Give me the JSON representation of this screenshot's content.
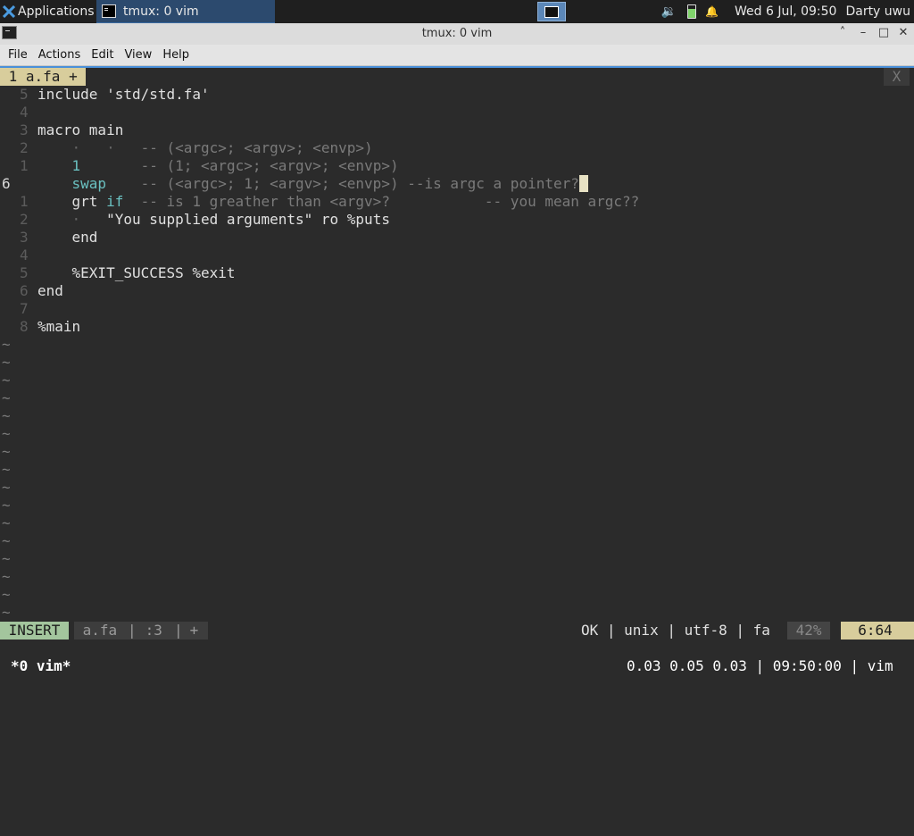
{
  "panel": {
    "apps_label": "Applications",
    "task_label": "tmux: 0 vim",
    "volume_icon": "🔉",
    "battery_icon": "▮",
    "bell_icon": "🔔",
    "clock": "Wed  6 Jul, 09:50",
    "user": "Darty uwu"
  },
  "window": {
    "title": "tmux: 0 vim",
    "minimize": "˄",
    "iconify": "–",
    "maximize": "□",
    "close": "✕"
  },
  "menu": [
    "File",
    "Actions",
    "Edit",
    "View",
    "Help"
  ],
  "vim": {
    "tab_label": " 1 a.fa + ",
    "tab_close": " X ",
    "lines": [
      {
        "nr": "5",
        "cur": false,
        "parts": [
          {
            "t": "include 'std/std.fa'",
            "c": ""
          }
        ]
      },
      {
        "nr": "4",
        "cur": false,
        "parts": []
      },
      {
        "nr": "3",
        "cur": false,
        "parts": [
          {
            "t": "macro main",
            "c": ""
          }
        ]
      },
      {
        "nr": "2",
        "cur": false,
        "parts": [
          {
            "t": "    ",
            "c": ""
          },
          {
            "t": "·   ·   ",
            "c": "dot"
          },
          {
            "t": "-- (<argc>; <argv>; <envp>)",
            "c": "cmt"
          }
        ]
      },
      {
        "nr": "1",
        "cur": false,
        "parts": [
          {
            "t": "    ",
            "c": ""
          },
          {
            "t": "1",
            "c": "kw"
          },
          {
            "t": "       ",
            "c": ""
          },
          {
            "t": "-- (1; <argc>; <argv>; <envp>)",
            "c": "cmt"
          }
        ]
      },
      {
        "nr": "6",
        "cur": true,
        "parts": [
          {
            "t": "    ",
            "c": ""
          },
          {
            "t": "swap",
            "c": "kw"
          },
          {
            "t": "    ",
            "c": ""
          },
          {
            "t": "-- (<argc>; 1; <argv>; <envp>) --is argc a pointer?",
            "c": "cmt"
          },
          {
            "t": " ",
            "c": "cursor"
          }
        ]
      },
      {
        "nr": "1",
        "cur": false,
        "parts": [
          {
            "t": "    grt ",
            "c": ""
          },
          {
            "t": "if",
            "c": "kw"
          },
          {
            "t": "  -- is 1 greather than <argv>?           -- you mean argc??",
            "c": "cmt"
          }
        ]
      },
      {
        "nr": "2",
        "cur": false,
        "parts": [
          {
            "t": "    ",
            "c": ""
          },
          {
            "t": "·",
            "c": "dot"
          },
          {
            "t": "   \"You supplied arguments\" ro %puts",
            "c": ""
          }
        ]
      },
      {
        "nr": "3",
        "cur": false,
        "parts": [
          {
            "t": "    end",
            "c": ""
          }
        ]
      },
      {
        "nr": "4",
        "cur": false,
        "parts": []
      },
      {
        "nr": "5",
        "cur": false,
        "parts": [
          {
            "t": "    %EXIT_SUCCESS %exit",
            "c": ""
          }
        ]
      },
      {
        "nr": "6",
        "cur": false,
        "parts": [
          {
            "t": "end",
            "c": ""
          }
        ]
      },
      {
        "nr": "7",
        "cur": false,
        "parts": []
      },
      {
        "nr": "8",
        "cur": false,
        "parts": [
          {
            "t": "%main",
            "c": ""
          }
        ]
      }
    ],
    "tilde": "~",
    "status": {
      "mode": " INSERT ",
      "file": " a.fa ",
      "sep1": "|",
      "line": " :3 ",
      "sep2": "|",
      "mod": " + ",
      "right": "OK | unix | utf-8 | fa ",
      "pct": " 42% ",
      "pos": "  6:64 "
    }
  },
  "tmux": {
    "window": "*0 vim*",
    "right": "0.03 0.05 0.03 | 09:50:00 | vim"
  }
}
